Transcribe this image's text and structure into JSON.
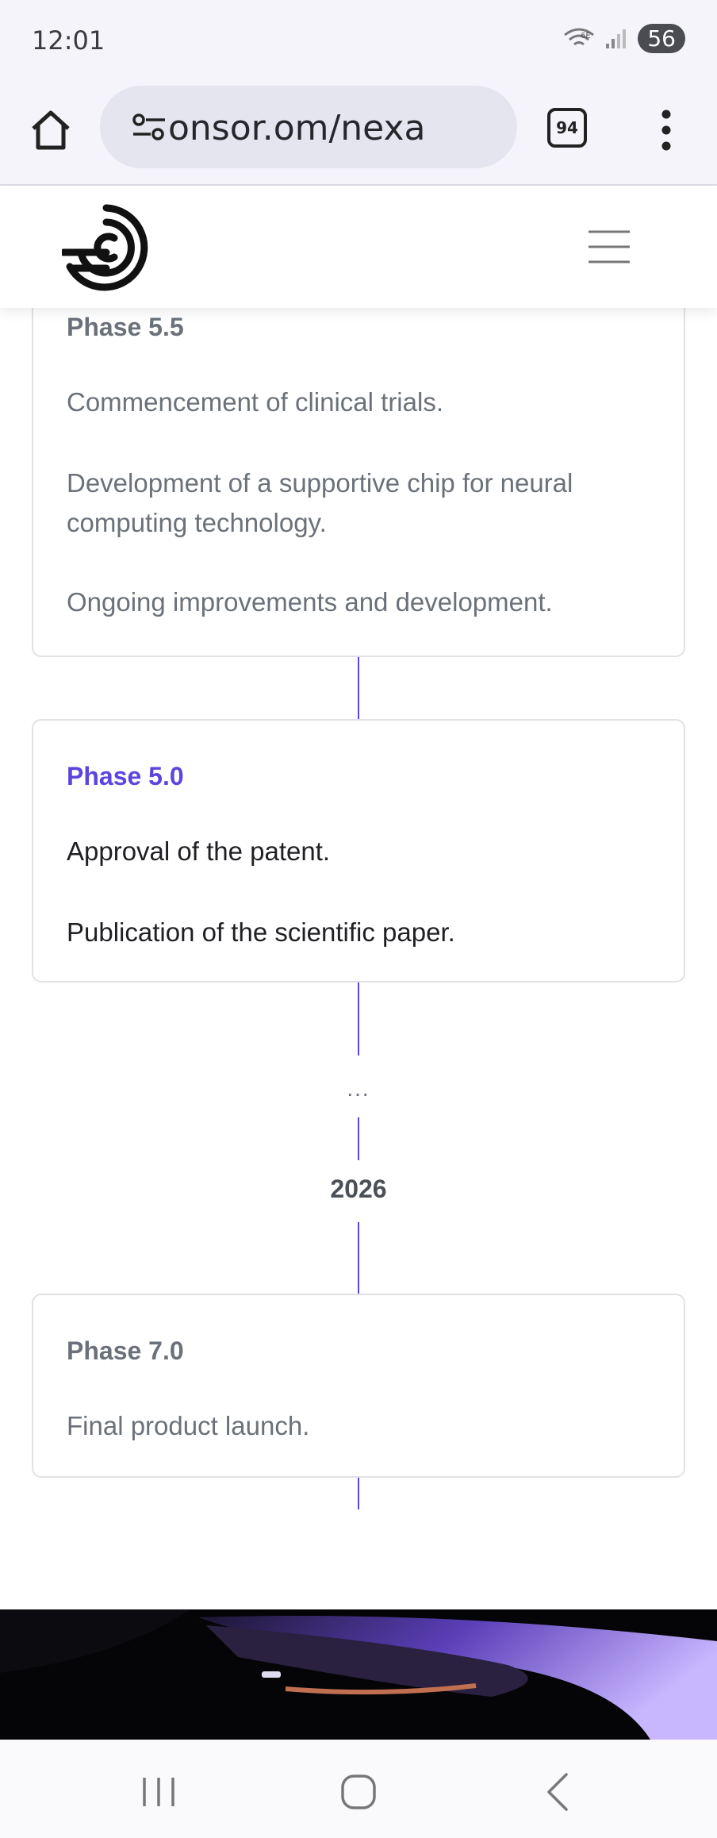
{
  "status_bar": {
    "time": "12:01",
    "battery": "56",
    "network": "6E"
  },
  "browser": {
    "url": "onsor.om/nexa",
    "tab_count": "94"
  },
  "timeline": {
    "phase_55": {
      "title": "Phase 5.5",
      "items": [
        "Commencement of clinical trials.",
        "Development of a supportive chip for neural computing technology.",
        "Ongoing improvements and development."
      ]
    },
    "phase_50": {
      "title": "Phase 5.0",
      "items": [
        "Approval of the patent.",
        "Publication of the scientific paper."
      ]
    },
    "ellipsis": "...",
    "year": "2026",
    "phase_70": {
      "title": "Phase 7.0",
      "items": [
        "Final product launch."
      ]
    }
  },
  "colors": {
    "accent": "#5b45e0",
    "muted_text": "#6b717a",
    "border": "#e1e1e6"
  }
}
